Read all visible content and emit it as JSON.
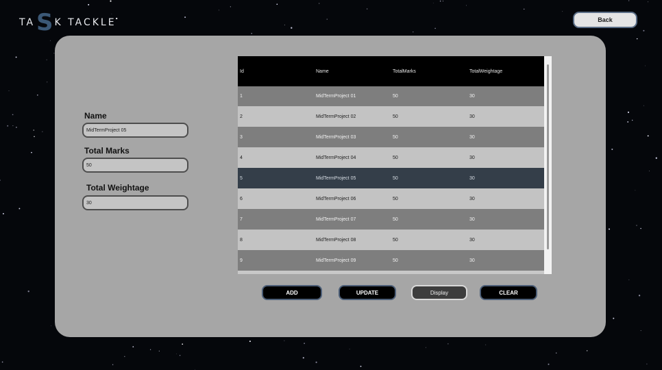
{
  "app": {
    "logo_part1": "TA",
    "logo_s": "S",
    "logo_part2": "K TACKLE",
    "back_label": "Back"
  },
  "form": {
    "name_label": "Name",
    "name_value": "MidTermProject 05",
    "marks_label": "Total Marks",
    "marks_value": "50",
    "weightage_label": "Total Weightage",
    "weightage_value": "30"
  },
  "table": {
    "columns": [
      "Id",
      "Name",
      "TotalMarks",
      "TotalWeightage"
    ],
    "rows": [
      {
        "id": "1",
        "name": "MidTermProject 01",
        "marks": "50",
        "weightage": "30"
      },
      {
        "id": "2",
        "name": "MidTermProject 02",
        "marks": "50",
        "weightage": "30"
      },
      {
        "id": "3",
        "name": "MidTermProject 03",
        "marks": "50",
        "weightage": "30"
      },
      {
        "id": "4",
        "name": "MidTermProject 04",
        "marks": "50",
        "weightage": "30"
      },
      {
        "id": "5",
        "name": "MidTermProject 05",
        "marks": "50",
        "weightage": "30"
      },
      {
        "id": "6",
        "name": "MidTermProject 06",
        "marks": "50",
        "weightage": "30"
      },
      {
        "id": "7",
        "name": "MidTermProject 07",
        "marks": "50",
        "weightage": "30"
      },
      {
        "id": "8",
        "name": "MidTermProject 08",
        "marks": "50",
        "weightage": "30"
      },
      {
        "id": "9",
        "name": "MidTermProject 09",
        "marks": "50",
        "weightage": "30"
      }
    ],
    "selected_row": "5"
  },
  "actions": {
    "add": "ADD",
    "update": "UPDATE",
    "display": "Display",
    "clear": "CLEAR"
  },
  "colors": {
    "background": "#05070b",
    "panel": "#a6a6a6",
    "header": "#000000",
    "row_dark": "#7e7e7e",
    "row_light": "#c3c3c3",
    "row_selected": "#343e49",
    "accent": "#3b5876"
  }
}
